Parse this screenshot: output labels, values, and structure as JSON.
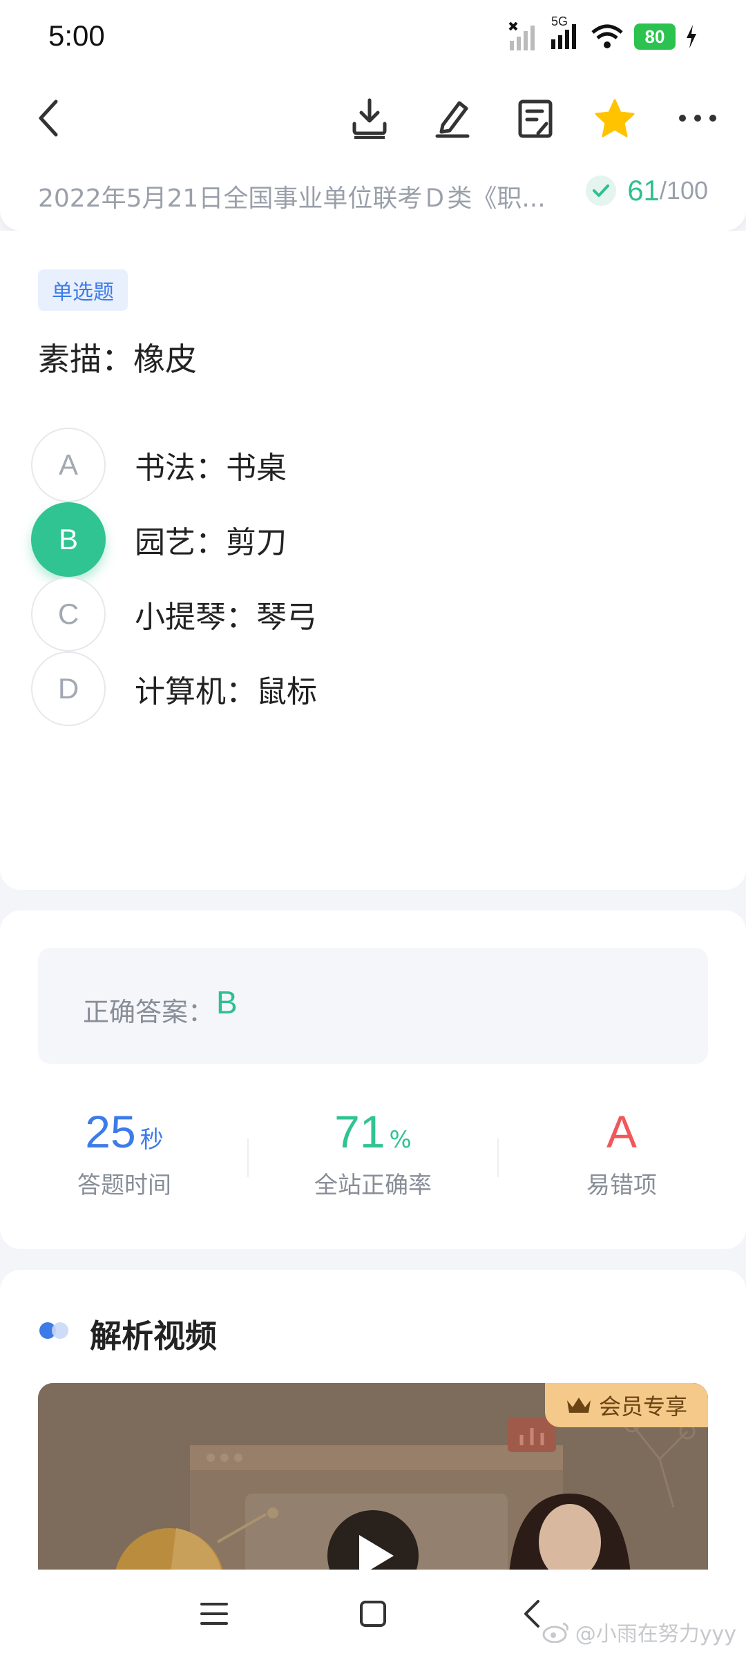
{
  "status_bar": {
    "time": "5:00",
    "network": "5G",
    "battery": "80"
  },
  "toolbar": {
    "icons": [
      "back-icon",
      "download-icon",
      "edit-icon",
      "notes-icon",
      "star-icon",
      "more-icon"
    ],
    "star_color": "#ffc300"
  },
  "paper": {
    "title": "2022年5月21日全国事业单位联考Ｄ类《职...",
    "score": "61",
    "total": "/100"
  },
  "question": {
    "type_tag": "单选题",
    "stem": "素描：橡皮",
    "options": [
      {
        "letter": "A",
        "text": "书法：书桌",
        "selected": false
      },
      {
        "letter": "B",
        "text": "园艺：剪刀",
        "selected": true
      },
      {
        "letter": "C",
        "text": "小提琴：琴弓",
        "selected": false
      },
      {
        "letter": "D",
        "text": "计算机：鼠标",
        "selected": false
      }
    ]
  },
  "answer": {
    "label": "正确答案：",
    "value": "B"
  },
  "stats": {
    "time_value": "25",
    "time_unit": "秒",
    "time_label": "答题时间",
    "rate_value": "71",
    "rate_unit": "%",
    "rate_label": "全站正确率",
    "error_value": "A",
    "error_label": "易错项"
  },
  "video": {
    "title": "解析视频",
    "vip_label": "会员专享"
  },
  "navbar": {
    "icons": [
      "menu-icon",
      "home-icon",
      "back-icon"
    ]
  },
  "watermark": "@小雨在努力yyy",
  "colors": {
    "accent_green": "#2fc492",
    "accent_blue": "#3d7be8",
    "accent_red": "#f0585a"
  }
}
